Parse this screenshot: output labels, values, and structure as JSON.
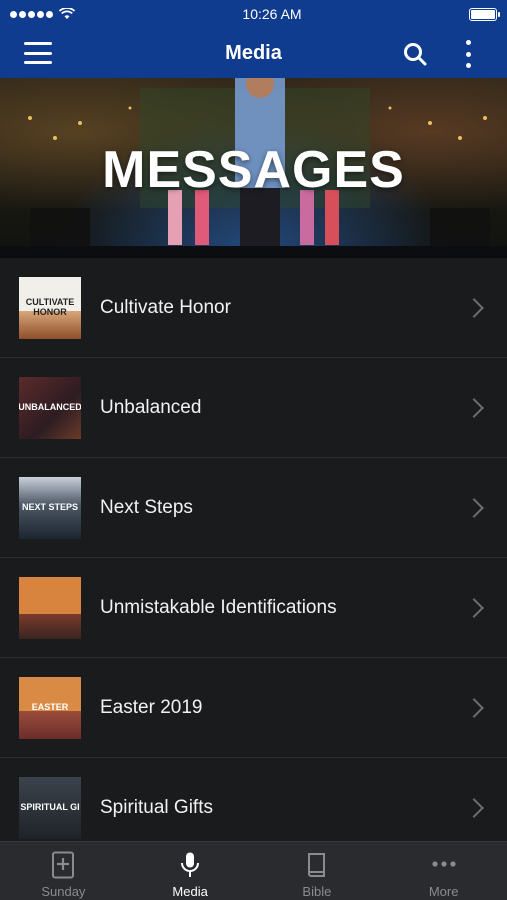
{
  "status_bar": {
    "time": "10:26 AM",
    "battery_level": 1.0
  },
  "nav": {
    "title": "Media"
  },
  "hero": {
    "title": "MESSAGES"
  },
  "series": [
    {
      "label": "Cultivate Honor",
      "thumb_text": "CULTIVATE HONOR"
    },
    {
      "label": "Unbalanced",
      "thumb_text": "UNBALANCED"
    },
    {
      "label": "Next Steps",
      "thumb_text": "NEXT STEPS"
    },
    {
      "label": "Unmistakable Identifications",
      "thumb_text": ""
    },
    {
      "label": "Easter 2019",
      "thumb_text": "EASTER"
    },
    {
      "label": "Spiritual Gifts",
      "thumb_text": "SPIRITUAL GI"
    }
  ],
  "tabs": [
    {
      "label": "Sunday",
      "icon": "bible-plus-icon",
      "active": false
    },
    {
      "label": "Media",
      "icon": "microphone-icon",
      "active": true
    },
    {
      "label": "Bible",
      "icon": "book-icon",
      "active": false
    },
    {
      "label": "More",
      "icon": "more-dots-icon",
      "active": false
    }
  ],
  "colors": {
    "nav_bg": "#0f3c8f",
    "list_bg": "#1a1b1d",
    "tab_bg": "#2a2b2e"
  }
}
